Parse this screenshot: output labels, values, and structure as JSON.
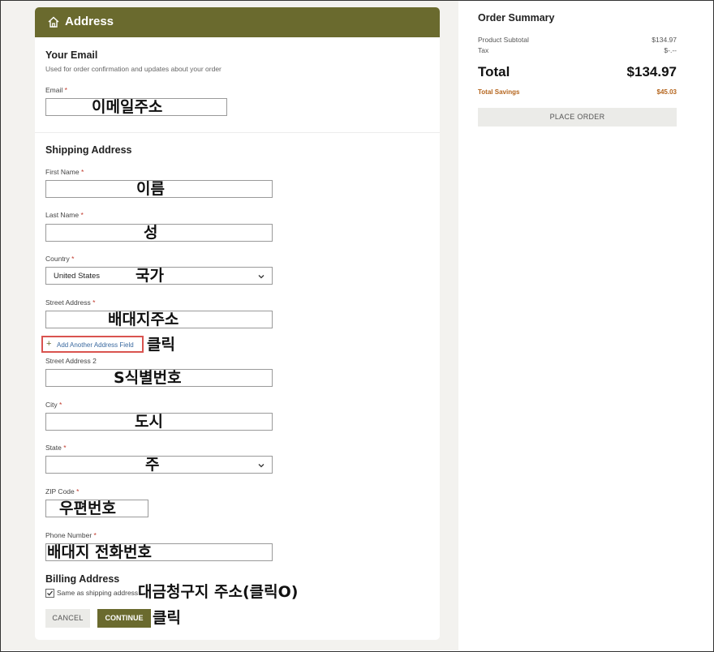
{
  "address_card": {
    "title": "Address",
    "email_section": {
      "heading": "Your Email",
      "subtext": "Used for order confirmation and updates about your order",
      "email_label": "Email",
      "email_note": "이메일주소"
    },
    "shipping": {
      "heading": "Shipping Address",
      "first_name_label": "First Name",
      "first_name_note": "이름",
      "last_name_label": "Last Name",
      "last_name_note": "성",
      "country_label": "Country",
      "country_value": "United States",
      "country_note": "국가",
      "street_label": "Street Address",
      "street_note": "배대지주소",
      "add_field_label": "Add Another Address Field",
      "add_field_note": "클릭",
      "street2_label": "Street Address 2",
      "street2_note": "S식별번호",
      "city_label": "City",
      "city_note": "도시",
      "state_label": "State",
      "state_note": "주",
      "zip_label": "ZIP Code",
      "zip_note": "우편번호",
      "phone_label": "Phone Number",
      "phone_note": "배대지 전화번호"
    },
    "billing": {
      "heading": "Billing Address",
      "same_as_label": "Same as shipping address",
      "note": "대금청구지 주소(클릭O)"
    },
    "buttons": {
      "cancel": "CANCEL",
      "continue": "CONTINUE",
      "continue_note": "클릭"
    },
    "required_mark": "*"
  },
  "order_summary": {
    "title": "Order Summary",
    "subtotal_label": "Product Subtotal",
    "subtotal_value": "$134.97",
    "tax_label": "Tax",
    "tax_value": "$-.--",
    "total_label": "Total",
    "total_value": "$134.97",
    "savings_label": "Total Savings",
    "savings_value": "$45.03",
    "place_order": "PLACE ORDER"
  },
  "colors": {
    "accent": "#6a6a2e",
    "savings": "#b5651d",
    "highlight_border": "#d9534f"
  },
  "icons": {
    "header": "home-icon",
    "select": "chevron-down-icon",
    "add": "plus-icon",
    "checkbox": "check-icon"
  }
}
